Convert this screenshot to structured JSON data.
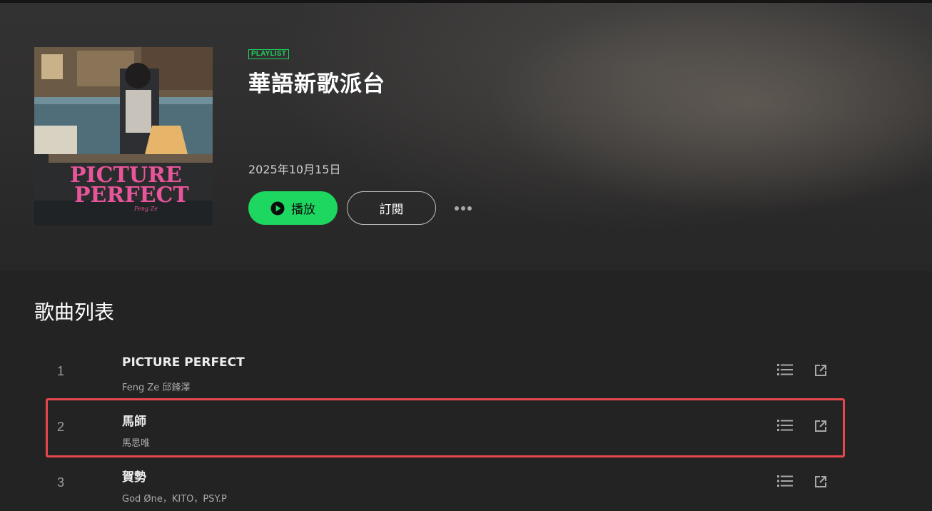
{
  "playlist": {
    "badge": "PLAYLIST",
    "title": "華語新歌派台",
    "date": "2025年10月15日",
    "play_label": "播放",
    "subscribe_label": "訂閱",
    "cover": {
      "title_line1": "PICTURE",
      "title_line2": "PERFECT",
      "small_text": "Feng Ze"
    }
  },
  "tracklist": {
    "heading": "歌曲列表",
    "tracks": [
      {
        "number": "1",
        "title": "PICTURE PERFECT",
        "artist": "Feng Ze 邱鋒澤"
      },
      {
        "number": "2",
        "title": "馬師",
        "artist": "馬思唯"
      },
      {
        "number": "3",
        "title": "賀勢",
        "artist": "God Øne，KITO，PSY.P"
      }
    ]
  },
  "colors": {
    "accent": "#1ed760",
    "highlight": "#e5484d",
    "background": "#232323"
  },
  "icons": {
    "play": "play-circle-icon",
    "more": "more-dots-icon",
    "queue": "list-icon",
    "open": "external-link-icon"
  }
}
